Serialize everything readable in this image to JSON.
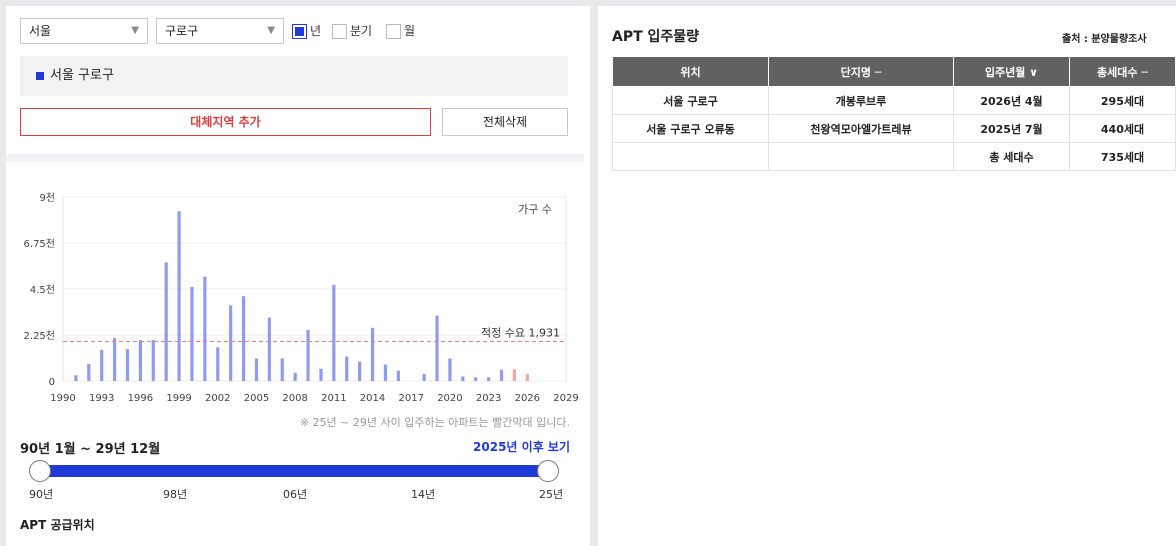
{
  "filters": {
    "region": "서울",
    "district": "구로구",
    "period_options": [
      {
        "label": "년",
        "checked": true
      },
      {
        "label": "분기",
        "checked": false
      },
      {
        "label": "월",
        "checked": false
      }
    ]
  },
  "selected_region": "서울 구로구",
  "buttons": {
    "add": "대체지역 추가",
    "delete_all": "전체삭제"
  },
  "chart_data": {
    "type": "bar",
    "series_label": "가구 수",
    "y_ticks": [
      "9천",
      "6.75천",
      "4.5천",
      "2.25천",
      "0"
    ],
    "ylim": [
      0,
      9000
    ],
    "x_ticks": [
      "1990",
      "1993",
      "1996",
      "1999",
      "2002",
      "2005",
      "2008",
      "2011",
      "2014",
      "2017",
      "2020",
      "2023",
      "2026",
      "2029"
    ],
    "xlim": [
      1990,
      2029
    ],
    "reference": {
      "label": "적정 수요 1,931",
      "value": 1931
    },
    "highlight_from": 2025,
    "colors": {
      "normal": "#8f9bef",
      "highlight": "#f4a6a6",
      "reference": "#f08080"
    },
    "x": [
      1991,
      1992,
      1993,
      1994,
      1995,
      1996,
      1997,
      1998,
      1999,
      2000,
      2001,
      2002,
      2003,
      2004,
      2005,
      2006,
      2007,
      2008,
      2009,
      2010,
      2011,
      2012,
      2013,
      2014,
      2015,
      2016,
      2017,
      2018,
      2019,
      2020,
      2021,
      2022,
      2023,
      2024,
      2025,
      2026
    ],
    "values": [
      280,
      840,
      1520,
      2100,
      1560,
      2000,
      2000,
      5800,
      8300,
      4600,
      5100,
      1650,
      3700,
      4150,
      1100,
      3100,
      1100,
      400,
      2500,
      600,
      4700,
      1200,
      950,
      2600,
      800,
      500,
      0,
      350,
      3200,
      1100,
      220,
      180,
      180,
      550,
      570,
      340
    ]
  },
  "chart_note": "※ 25년 ~ 29년 사이 입주하는 아파트는 빨간막대 입니다.",
  "range": {
    "title": "90년 1월 ~ 29년 12월",
    "link": "2025년 이후 보기",
    "labels": [
      "90년",
      "98년",
      "06년",
      "14년",
      "25년"
    ]
  },
  "supply_title": "APT 공급위치",
  "right": {
    "title": "APT 입주물량",
    "source": "출처 : 분양물량조사",
    "headers": [
      "위치",
      "단지명 ─",
      "입주년월 ∨",
      "총세대수 ─"
    ],
    "rows": [
      [
        "서울 구로구",
        "개봉루브루",
        "2026년 4월",
        "295세대"
      ],
      [
        "서울 구로구 오류동",
        "천왕역모아엘가트레뷰",
        "2025년 7월",
        "440세대"
      ],
      [
        "",
        "",
        "총 세대수",
        "735세대"
      ]
    ]
  }
}
